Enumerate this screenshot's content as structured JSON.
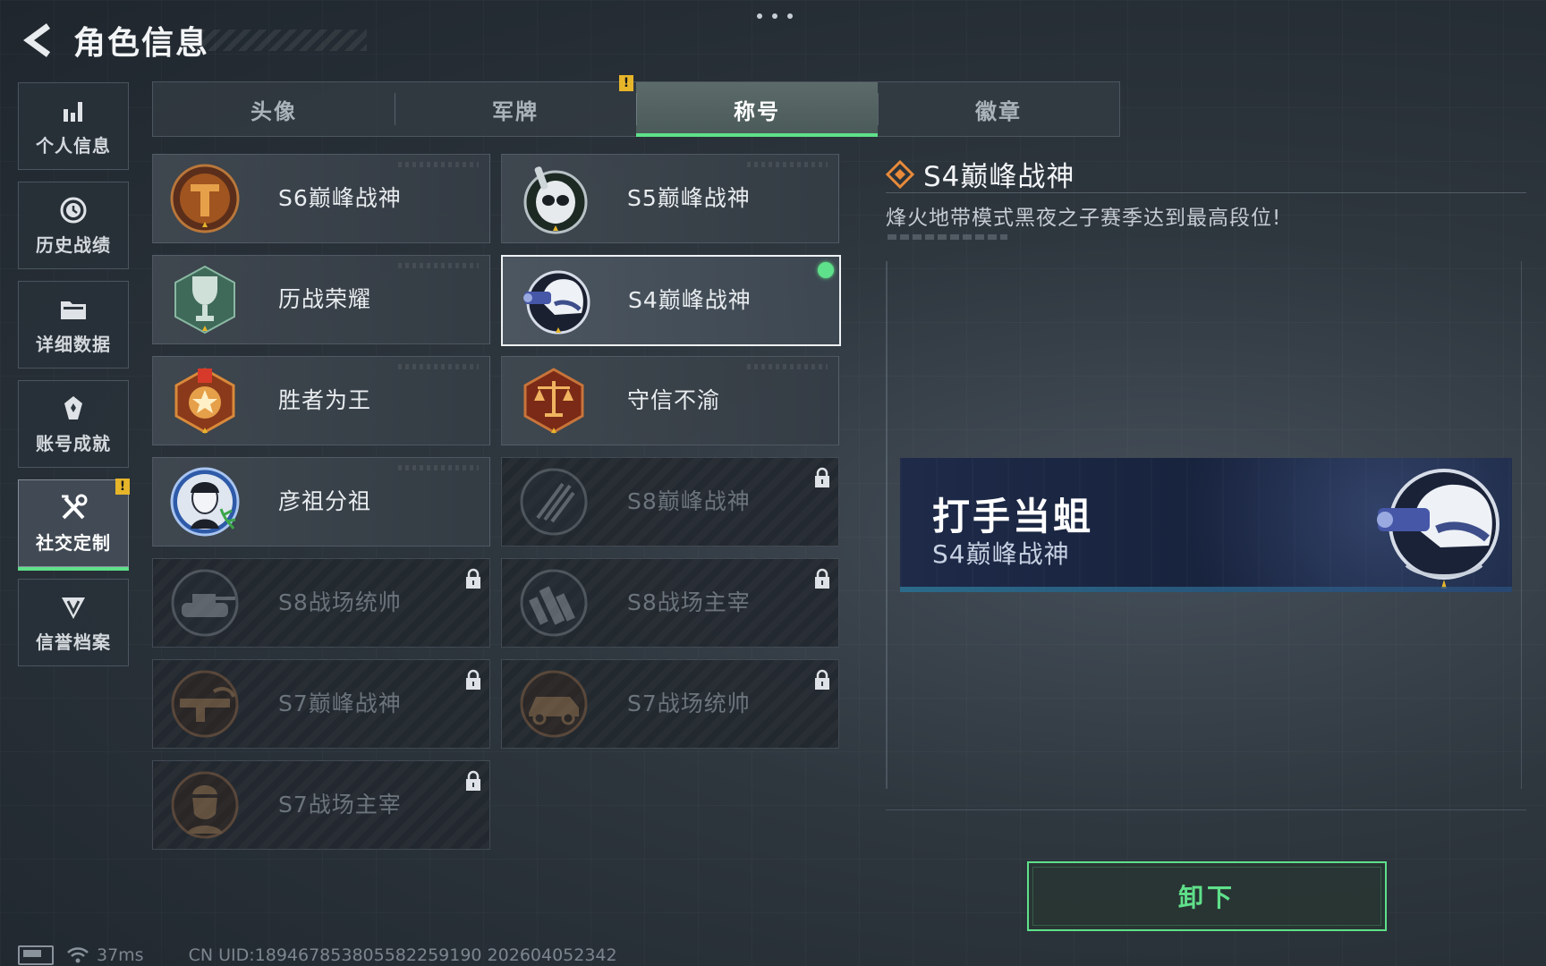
{
  "header": {
    "title": "角色信息"
  },
  "sidebar": {
    "items": [
      {
        "label": "个人信息",
        "icon": "bar-chart-icon",
        "active": false
      },
      {
        "label": "历史战绩",
        "icon": "history-clock-icon",
        "active": false
      },
      {
        "label": "详细数据",
        "icon": "folder-icon",
        "active": false
      },
      {
        "label": "账号成就",
        "icon": "achievement-icon",
        "active": false
      },
      {
        "label": "社交定制",
        "icon": "wrench-screwdriver-icon",
        "active": true,
        "badge": "!"
      },
      {
        "label": "信誉档案",
        "icon": "shield-v-icon",
        "active": false
      }
    ]
  },
  "tabs": [
    {
      "label": "头像",
      "active": false
    },
    {
      "label": "军牌",
      "active": false,
      "badge": "!"
    },
    {
      "label": "称号",
      "active": true
    },
    {
      "label": "徽章",
      "active": false
    }
  ],
  "titles": [
    {
      "label": "S6巅峰战神",
      "locked": false,
      "emblem": "bronze-t-emblem-icon"
    },
    {
      "label": "S5巅峰战神",
      "locked": false,
      "emblem": "skull-helmet-emblem-icon"
    },
    {
      "label": "历战荣耀",
      "locked": false,
      "emblem": "trophy-emblem-icon"
    },
    {
      "label": "S4巅峰战神",
      "locked": false,
      "selected": true,
      "emblem": "night-vision-helmet-emblem-icon"
    },
    {
      "label": "胜者为王",
      "locked": false,
      "emblem": "medal-emblem-icon"
    },
    {
      "label": "守信不渝",
      "locked": false,
      "emblem": "scales-emblem-icon"
    },
    {
      "label": "彦祖分祖",
      "locked": false,
      "emblem": "portrait-emblem-icon"
    },
    {
      "label": "S8巅峰战神",
      "locked": true,
      "emblem": "slash-emblem-icon"
    },
    {
      "label": "S8战场统帅",
      "locked": true,
      "emblem": "tank-emblem-icon"
    },
    {
      "label": "S8战场主宰",
      "locked": true,
      "emblem": "city-emblem-icon"
    },
    {
      "label": "S7巅峰战神",
      "locked": true,
      "emblem": "gun-emblem-icon"
    },
    {
      "label": "S7战场统帅",
      "locked": true,
      "emblem": "vehicle-emblem-icon"
    },
    {
      "label": "S7战场主宰",
      "locked": true,
      "emblem": "soldier-emblem-icon"
    }
  ],
  "detail": {
    "title": "S4巅峰战神",
    "description": "烽火地带模式黑夜之子赛季达到最高段位!",
    "banner": {
      "player_name": "打手当蛆",
      "title": "S4巅峰战神"
    },
    "unequip_label": "卸下"
  },
  "footer": {
    "ping": "37ms",
    "uid": "CN UID:18946785380558225919​0 202604052342"
  },
  "colors": {
    "accent": "#5fe08a",
    "warning": "#e6b52a",
    "selected_border": "#eef2f5"
  }
}
